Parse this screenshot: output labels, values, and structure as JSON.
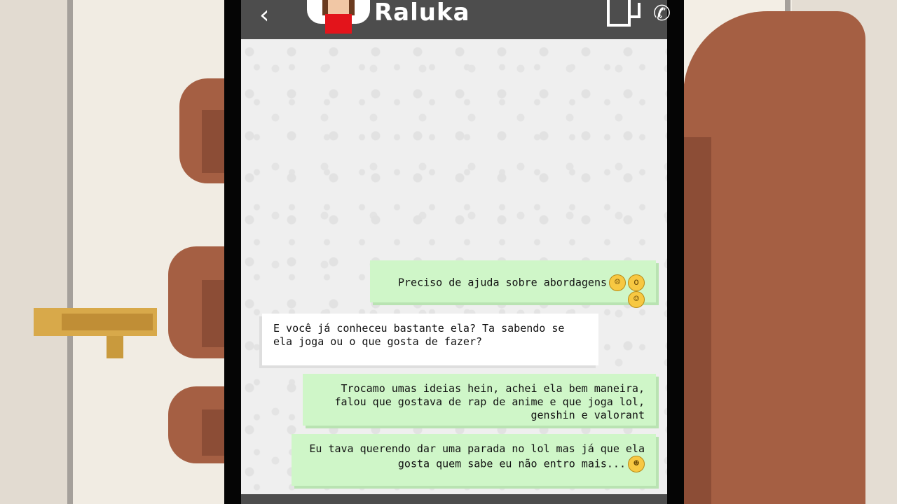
{
  "header": {
    "contact_name": "Raluka",
    "back_icon": "back-chevron-icon",
    "video_icon": "video-call-icon",
    "call_icon": "phone-call-icon"
  },
  "messages": [
    {
      "from": "me",
      "text": "Preciso de ajuda sobre abordagens",
      "emojis": [
        "worried-face-icon",
        "screaming-face-icon",
        "shushing-face-icon"
      ]
    },
    {
      "from": "contact",
      "text": "E você já conheceu bastante ela? Ta sabendo se ela joga ou o que gosta de fazer?",
      "emojis": []
    },
    {
      "from": "me",
      "text": "Trocamo umas ideias hein, achei ela bem maneira, falou que gostava de rap de anime e que joga lol, genshin e valorant",
      "emojis": []
    },
    {
      "from": "me",
      "text": "Eu tava querendo dar uma parada no lol mas já que ela gosta quem sabe eu não entro mais...",
      "emojis": [
        "tongue-out-face-icon"
      ]
    }
  ],
  "colors": {
    "sent_bubble": "#cff6c8",
    "received_bubble": "#ffffff",
    "header": "#4d4d4d",
    "skin": "#a55f43",
    "door_handle": "#d8a94a"
  }
}
